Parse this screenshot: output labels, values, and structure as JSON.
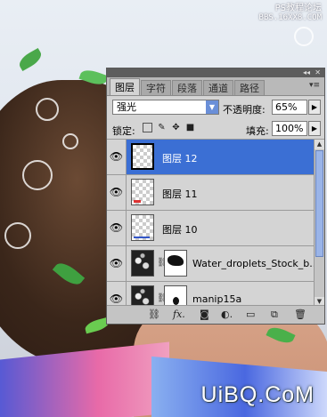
{
  "watermark_top": {
    "line1": "PS教程论坛",
    "line2": "BBS.16XX8.COM"
  },
  "watermark_bottom": "UiBQ.CoM",
  "panel": {
    "tabs": [
      "图层",
      "字符",
      "段落",
      "通道",
      "路径"
    ],
    "active_tab": "图层",
    "blend_mode": "强光",
    "opacity_label": "不透明度:",
    "opacity_value": "65%",
    "lock_label": "锁定:",
    "fill_label": "填充:",
    "fill_value": "100%",
    "layers": [
      {
        "name": "图层 12",
        "visible": true,
        "selected": true
      },
      {
        "name": "图层 11",
        "visible": true,
        "selected": false
      },
      {
        "name": "图层 10",
        "visible": true,
        "selected": false
      },
      {
        "name": "Water_droplets_Stock_b...",
        "visible": true,
        "selected": false,
        "has_mask": true
      },
      {
        "name": "manip15a",
        "visible": true,
        "selected": false,
        "has_mask": true
      }
    ]
  },
  "colors": {
    "selection": "#3b6fd4",
    "panel_bg": "#d4d4d4",
    "titlebar": "#5d5d5d"
  },
  "icons": [
    "eye-icon",
    "link-icon",
    "fx-icon",
    "mask-icon",
    "adjustment-icon",
    "folder-icon",
    "new-layer-icon",
    "trash-icon"
  ]
}
